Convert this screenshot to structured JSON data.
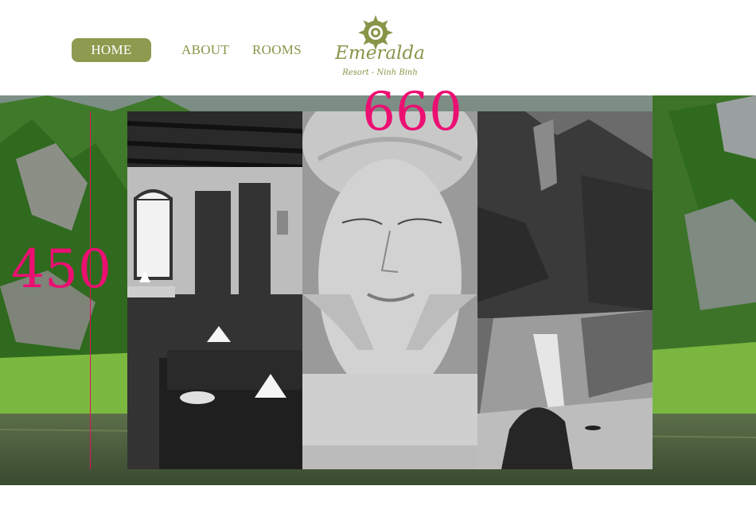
{
  "nav": {
    "home": "HOME",
    "about": "ABOUT",
    "rooms": "ROOMS",
    "accent_color": "#8e9a4f"
  },
  "logo": {
    "name": "Emeralda",
    "subtitle": "Resort - Ninh Binh"
  },
  "annotations": {
    "width": "660",
    "height": "450",
    "color": "#ec0f72"
  },
  "gallery": {
    "panels": [
      "restaurant-photo",
      "spa-photo",
      "landscape-photo"
    ]
  }
}
